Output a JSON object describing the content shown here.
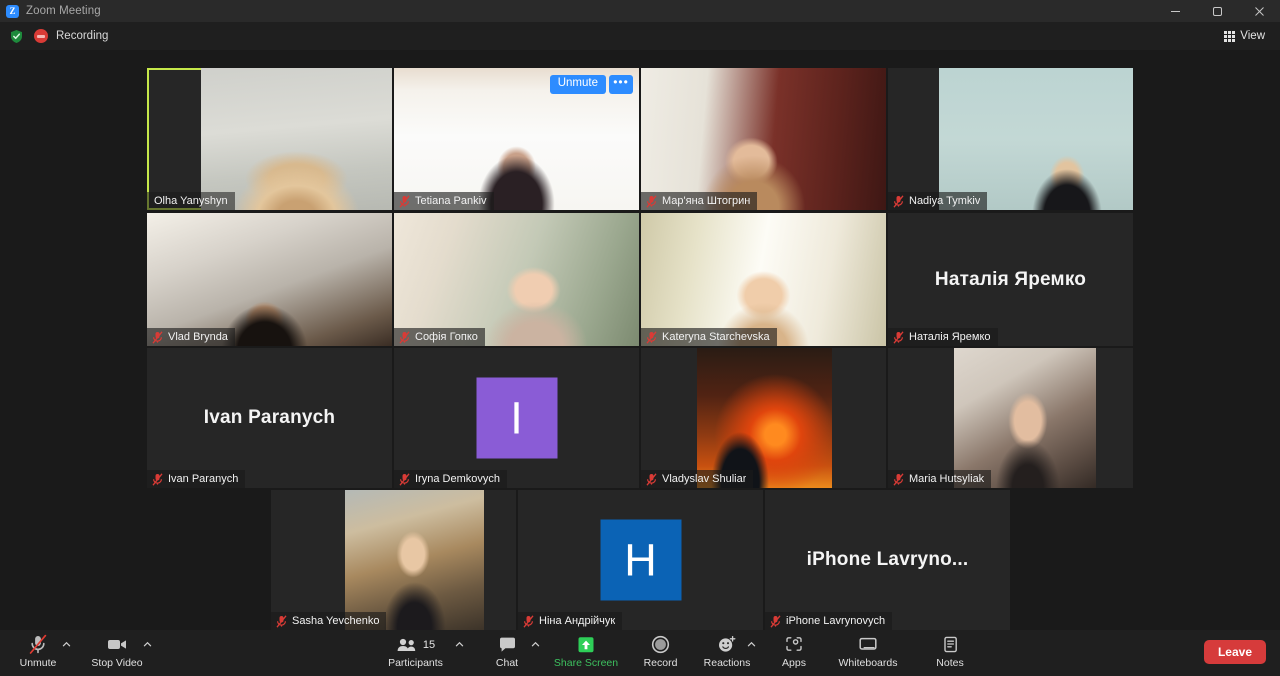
{
  "window": {
    "app_icon": "zoom-logo-icon",
    "title": "Zoom Meeting",
    "minimize": "minimize-icon",
    "maximize": "maximize-icon",
    "close": "close-icon"
  },
  "statusbar": {
    "encryption_icon": "green-shield-icon",
    "recording_icon": "recording-dot-icon",
    "recording_label": "Recording",
    "view_label": "View",
    "view_icon": "grid-icon"
  },
  "colors": {
    "active_speaker_border": "#c6e84a",
    "accent_blue": "#2d8cff",
    "leave_red": "#d63b3b",
    "share_green": "#3dc05f",
    "recording_red": "#d93b36",
    "window_bg": "#1a1a1a",
    "toolbar_bg": "#1f1f1f"
  },
  "gallery": {
    "rows": [
      {
        "tiles": [
          {
            "name": "Olha Yanyshyn",
            "video": true,
            "muted": false,
            "active_speaker": true,
            "bg": "bg-olha",
            "vx": "22%",
            "vw": "78%"
          },
          {
            "name": "Tetiana Pankiv",
            "video": true,
            "muted": true,
            "hover_controls": true,
            "unmute_label": "Unmute",
            "more_label": "•••",
            "bg": "bg-tetiana",
            "vx": "0%",
            "vw": "100%"
          },
          {
            "name": "Мар'яна Штогрин",
            "video": true,
            "muted": true,
            "bg": "bg-mariana",
            "vx": "0%",
            "vw": "100%"
          },
          {
            "name": "Nadiya Tymkiv",
            "video": true,
            "muted": true,
            "bg": "bg-nadiya",
            "vx": "21%",
            "vw": "79%"
          }
        ]
      },
      {
        "tiles": [
          {
            "name": "Vlad Brynda",
            "video": true,
            "muted": true,
            "bg": "bg-vlad",
            "vx": "0%",
            "vw": "100%"
          },
          {
            "name": "Софія Гопко",
            "video": true,
            "muted": true,
            "bg": "bg-sofia",
            "vx": "0%",
            "vw": "100%"
          },
          {
            "name": "Kateryna Starchevska",
            "video": true,
            "muted": true,
            "bg": "bg-kateryna",
            "vx": "0%",
            "vw": "100%"
          },
          {
            "name": "Наталія Яремко",
            "video": false,
            "muted": true,
            "display_name": "Наталія Яремко"
          }
        ]
      },
      {
        "tiles": [
          {
            "name": "Ivan Paranych",
            "video": false,
            "muted": true,
            "display_name": "Ivan Paranych"
          },
          {
            "name": "Iryna Demkovych",
            "video": false,
            "muted": true,
            "avatar_letter": "I",
            "avatar_color": "#8a5cd6"
          },
          {
            "name": "Vladyslav Shuliar",
            "video": true,
            "muted": true,
            "bg": "bg-vlady",
            "vx": "23%",
            "vw": "55%"
          },
          {
            "name": "Maria Hutsyliak",
            "video": true,
            "muted": true,
            "bg": "bg-maria",
            "vx": "27%",
            "vw": "58%"
          }
        ]
      },
      {
        "tiles": [
          {
            "name": "Sasha Yevchenko",
            "video": true,
            "muted": true,
            "bg": "bg-sasha",
            "vx": "30%",
            "vw": "57%"
          },
          {
            "name": "Ніна Андрійчук",
            "video": false,
            "muted": true,
            "avatar_letter": "H",
            "avatar_color": "#0b63b5"
          },
          {
            "name": "iPhone Lavrynovych",
            "video": false,
            "muted": true,
            "display_name": "iPhone  Lavryno..."
          }
        ]
      }
    ]
  },
  "toolbar": {
    "mute": {
      "label": "Unmute",
      "icon": "microphone-muted-icon",
      "caret": true
    },
    "video": {
      "label": "Stop Video",
      "icon": "camera-icon",
      "caret": true
    },
    "participants": {
      "label": "Participants",
      "icon": "participants-icon",
      "count": "15",
      "caret": true
    },
    "chat": {
      "label": "Chat",
      "icon": "chat-bubble-icon",
      "caret": true
    },
    "share": {
      "label": "Share Screen",
      "icon": "share-screen-icon",
      "caret": false
    },
    "record": {
      "label": "Record",
      "icon": "record-circle-icon",
      "caret": false
    },
    "reactions": {
      "label": "Reactions",
      "icon": "reactions-smiley-icon",
      "caret": true
    },
    "apps": {
      "label": "Apps",
      "icon": "apps-icon",
      "caret": false
    },
    "whiteboards": {
      "label": "Whiteboards",
      "icon": "whiteboard-icon",
      "caret": false
    },
    "notes": {
      "label": "Notes",
      "icon": "notes-icon",
      "caret": false
    },
    "leave": {
      "label": "Leave"
    }
  }
}
